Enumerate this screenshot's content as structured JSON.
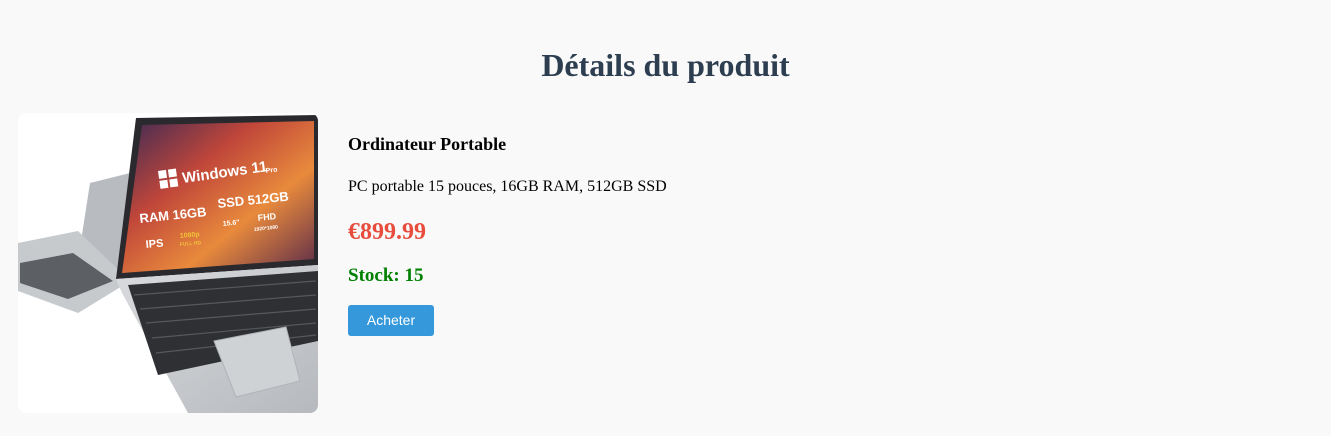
{
  "page": {
    "title": "Détails du produit"
  },
  "product": {
    "name": "Ordinateur Portable",
    "description": "PC portable 15 pouces, 16GB RAM, 512GB SSD",
    "price": "€899.99",
    "stock": "Stock: 15",
    "buy_label": "Acheter",
    "image": {
      "screen_text": {
        "os": "Windows 11",
        "edition": "Pro",
        "ram": "RAM 16GB",
        "ssd": "SSD 512GB",
        "size": "15.6\"",
        "fhd": "FHD",
        "resolution": "1920*1080",
        "ips": "IPS",
        "hd": "1080p",
        "fullhd": "FULL HD"
      }
    }
  },
  "colors": {
    "title": "#2c3e50",
    "price": "#e74c3c",
    "stock": "#008000",
    "button": "#3498db"
  }
}
